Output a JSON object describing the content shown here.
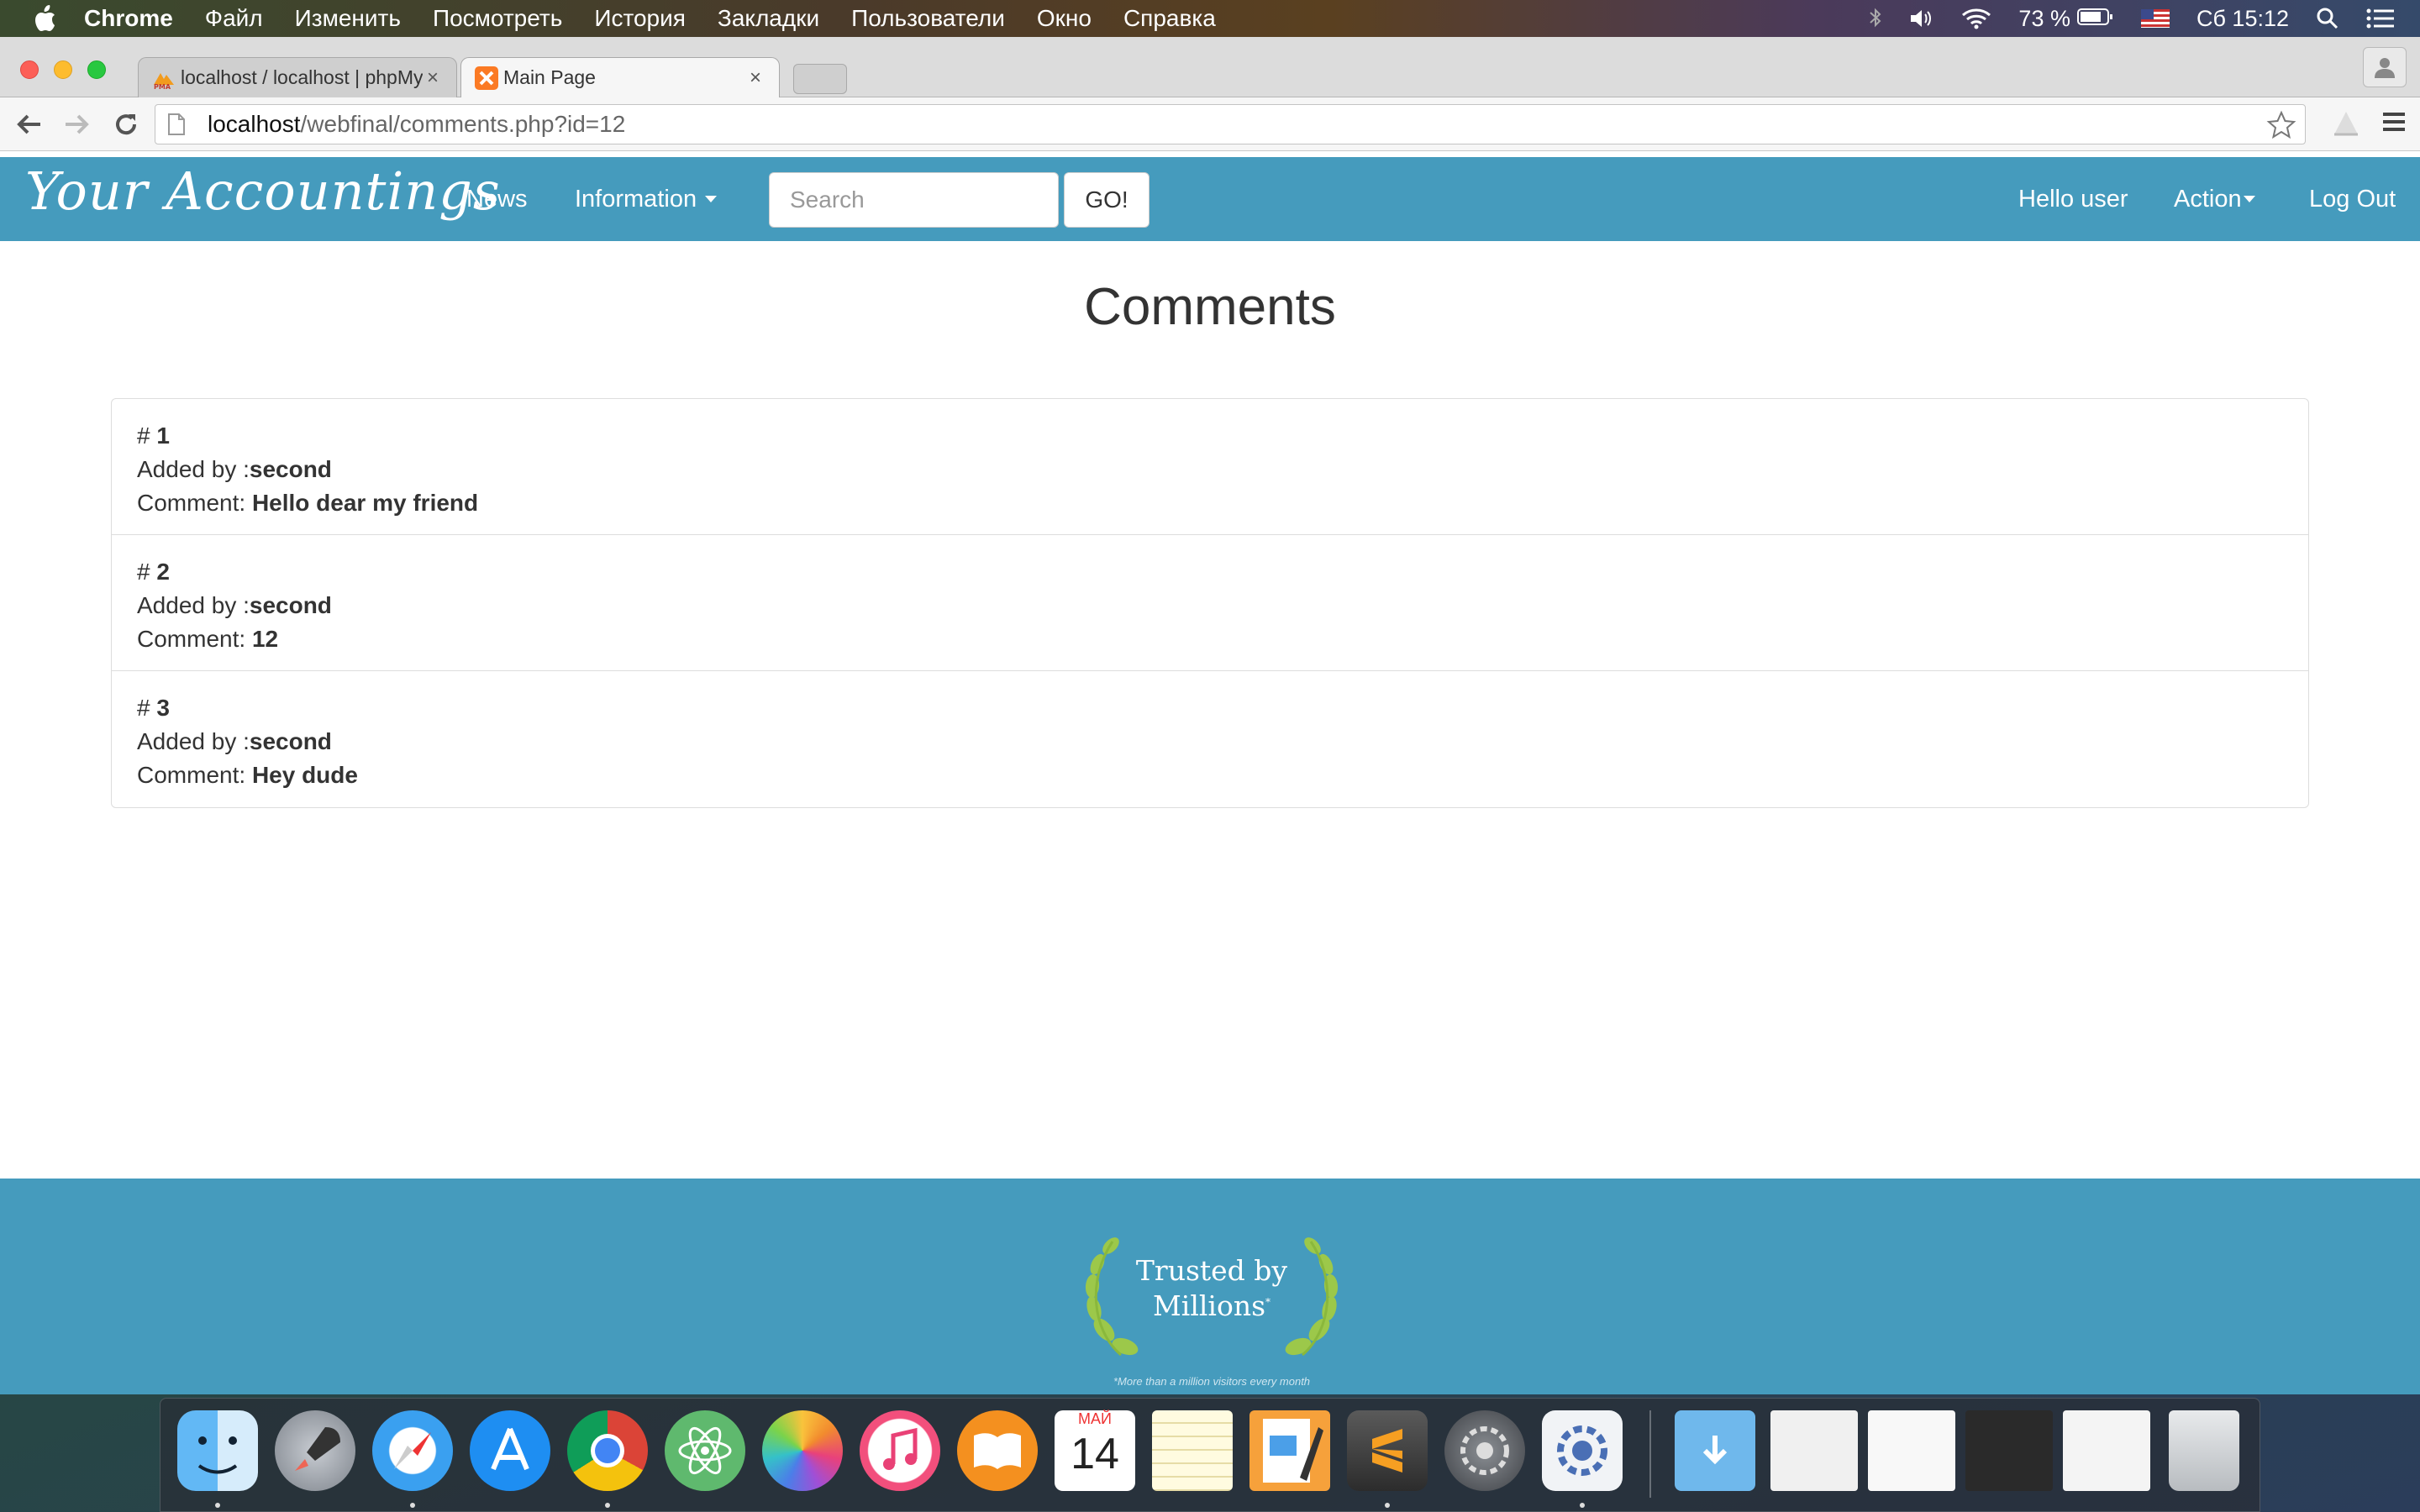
{
  "menubar": {
    "app_name": "Chrome",
    "items": [
      "Файл",
      "Изменить",
      "Посмотреть",
      "История",
      "Закладки",
      "Пользователи",
      "Окно",
      "Справка"
    ],
    "battery": "73 %",
    "clock": "Сб 15:12"
  },
  "browser": {
    "tabs": [
      {
        "title": "localhost / localhost | phpMyAdmin",
        "icon": "phpmyadmin-icon",
        "active": false
      },
      {
        "title": "Main Page",
        "icon": "xampp-icon",
        "active": true
      }
    ],
    "url": {
      "host": "localhost",
      "path": "/webfinal/comments.php?id=12"
    }
  },
  "navbar": {
    "brand": "Your Accountings",
    "links": {
      "news": "News",
      "information": "Information"
    },
    "search": {
      "placeholder": "Search",
      "value": "",
      "button": "GO!"
    },
    "right": {
      "greeting": "Hello user",
      "action": "Action",
      "logout": "Log Out"
    },
    "color": "#459bbd"
  },
  "page": {
    "title": "Comments",
    "comments": [
      {
        "number_prefix": "# ",
        "number": "1",
        "added_by_label": "Added by :",
        "author": "second",
        "comment_label": "Comment: ",
        "text": "Hello dear my friend"
      },
      {
        "number_prefix": "# ",
        "number": "2",
        "added_by_label": "Added by :",
        "author": "second",
        "comment_label": "Comment: ",
        "text": "12"
      },
      {
        "number_prefix": "# ",
        "number": "3",
        "added_by_label": "Added by :",
        "author": "second",
        "comment_label": "Comment: ",
        "text": "Hey dude"
      }
    ]
  },
  "footer": {
    "badge_line1": "Trusted by",
    "badge_line2": "Millions",
    "badge_mark": "*",
    "note": "*More than a million visitors every month"
  },
  "dock": {
    "apps": [
      "finder-icon",
      "launchpad-icon",
      "safari-icon",
      "app-store-icon",
      "chrome-icon",
      "atom-icon",
      "photos-icon",
      "itunes-icon",
      "ibooks-icon",
      "calendar-icon",
      "notes-icon",
      "pages-icon",
      "sublime-text-icon",
      "system-preferences-icon",
      "xampp-manager-icon"
    ],
    "calendar": {
      "month": "МАЙ",
      "day": "14"
    },
    "right_items": [
      "downloads-folder-icon",
      "window-thumbnail-1",
      "window-thumbnail-2",
      "window-thumbnail-3",
      "window-thumbnail-4",
      "trash-icon"
    ]
  }
}
